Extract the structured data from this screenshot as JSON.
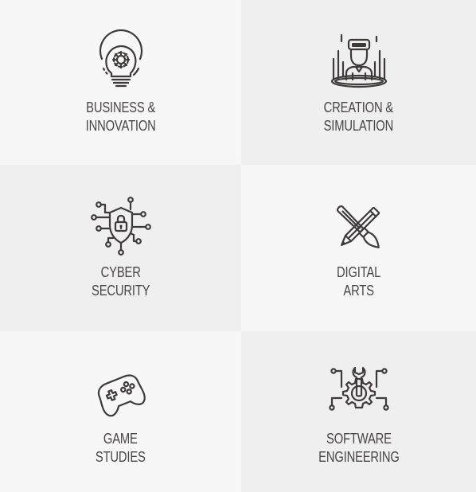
{
  "tiles": [
    {
      "line1": "BUSINESS &",
      "line2": "INNOVATION",
      "icon": "lightbulb-gear-icon"
    },
    {
      "line1": "CREATION &",
      "line2": "SIMULATION",
      "icon": "vr-headset-person-icon"
    },
    {
      "line1": "CYBER",
      "line2": "SECURITY",
      "icon": "shield-lock-circuit-icon"
    },
    {
      "line1": "DIGITAL",
      "line2": "ARTS",
      "icon": "pencil-brush-crossed-icon"
    },
    {
      "line1": "GAME",
      "line2": "STUDIES",
      "icon": "gamepad-icon"
    },
    {
      "line1": "SOFTWARE",
      "line2": "ENGINEERING",
      "icon": "gear-wrench-icon"
    }
  ],
  "colors": {
    "tile_light": "#f7f7f7",
    "tile_dark": "#efefef",
    "text": "#4a4544",
    "icon_stroke": "#3f3a39"
  }
}
